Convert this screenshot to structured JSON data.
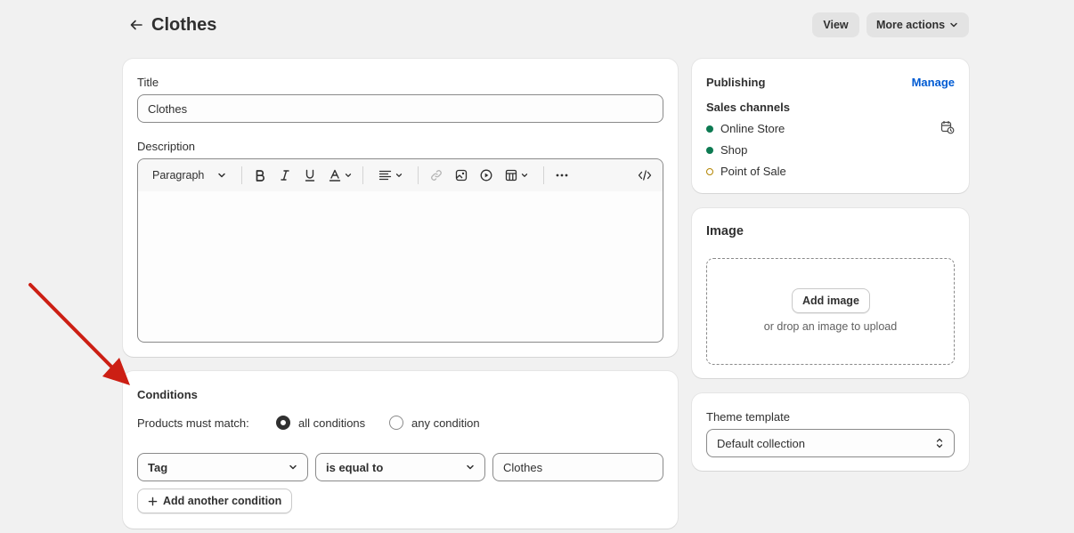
{
  "header": {
    "title": "Clothes",
    "view_label": "View",
    "more_actions_label": "More actions"
  },
  "main": {
    "title_label": "Title",
    "title_value": "Clothes",
    "description_label": "Description",
    "toolbar": {
      "paragraph_label": "Paragraph"
    }
  },
  "conditions": {
    "heading": "Conditions",
    "match_label": "Products must match:",
    "option_all": "all conditions",
    "option_any": "any condition",
    "selected_option": "all conditions",
    "field_value": "Tag",
    "operator_value": "is equal to",
    "value_input": "Clothes",
    "add_button": "Add another condition"
  },
  "publishing": {
    "heading": "Publishing",
    "manage_label": "Manage",
    "subheading": "Sales channels",
    "channels": [
      {
        "name": "Online Store",
        "status": "active"
      },
      {
        "name": "Shop",
        "status": "active"
      },
      {
        "name": "Point of Sale",
        "status": "inactive"
      }
    ]
  },
  "image": {
    "heading": "Image",
    "add_button": "Add image",
    "hint": "or drop an image to upload"
  },
  "theme": {
    "label": "Theme template",
    "selected": "Default collection"
  },
  "colors": {
    "link": "#005bd3",
    "active_dot": "#0d7a52",
    "inactive_dot": "#b28400",
    "annotation_arrow": "#cc1f14"
  }
}
